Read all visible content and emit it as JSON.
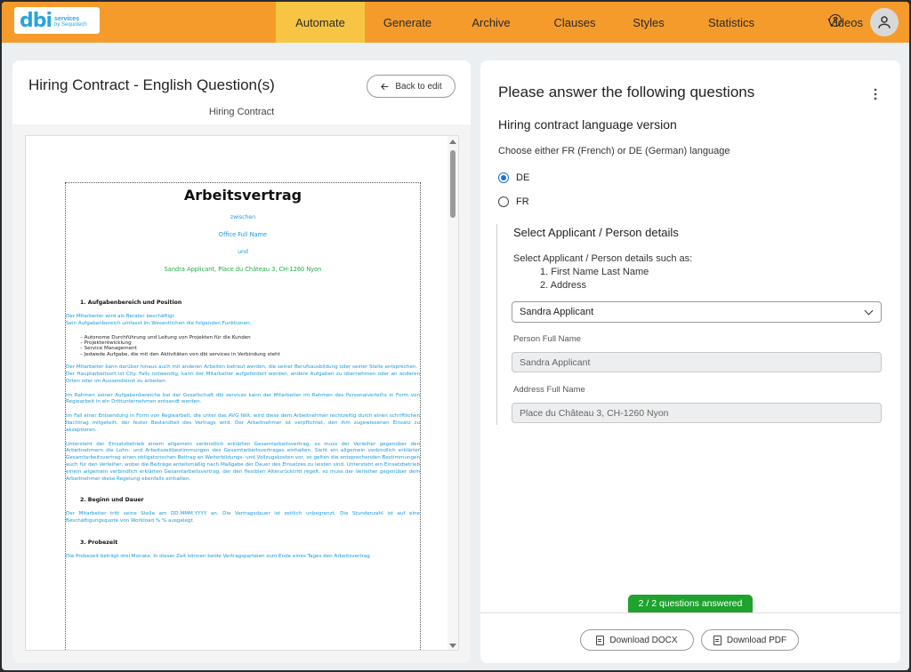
{
  "logo": {
    "brand": "dbi",
    "sub_top": "services",
    "sub_bottom": "by Sequotech"
  },
  "nav": {
    "items": [
      {
        "label": "Automate",
        "active": true
      },
      {
        "label": "Generate",
        "active": false
      },
      {
        "label": "Archive",
        "active": false
      },
      {
        "label": "Clauses",
        "active": false
      },
      {
        "label": "Styles",
        "active": false
      },
      {
        "label": "Statistics",
        "active": false
      },
      {
        "label": "Videos",
        "active": false
      }
    ],
    "help_icon": "?"
  },
  "left": {
    "title": "Hiring Contract - English Question(s)",
    "back_label": "Back to edit",
    "subtitle": "Hiring Contract",
    "document": {
      "heading": "Arbeitsvertrag",
      "between": "zwischen",
      "party1": "Office Full Name",
      "and": "und",
      "party2": "Sandra Applicant, Place du Château 3, CH-1260 Nyon",
      "sec1": "1.    Aufgabenbereich und Position",
      "p1": "Der Mitarbeiter wird als Berater beschäftigt.",
      "p1b": "Sein Aufgabenbereich umfasst im Wesentlichen die folgenden Funktionen:",
      "list": [
        "–   Autonome Durchführung und Leitung von Projekten für die Kunden",
        "–   Projektentwicklung",
        "–   Service Management",
        "–   Jedwede Aufgabe, die mit den Aktivitäten von dbi services in Verbindung steht"
      ],
      "p2": "Der Mitarbeiter kann darüber hinaus auch mit anderen Arbeiten betraut werden, die seiner Berufsausbildung oder seiner Stelle entsprechen.",
      "p3": "Der Hauptarbeitsort ist City. Falls notwendig, kann der Mitarbeiter aufgefordert werden, andere Aufgaben zu übernehmen oder an anderen Orten oder im Aussendienst zu arbeiten.",
      "p4": "Im Rahmen seiner Aufgabenbereiche bei der Gesellschaft dbi services kann der Mitarbeiter im Rahmen des Personalverleihs in Form von Regiearbeit in ein Drittunternehmen entsandt werden.",
      "p5": "Im Fall einer Entsendung in Form von Regiearbeit, die unter das AVG fällt, wird diese dem Arbeitnehmer rechtzeitig durch einen schriftlichen Nachtrag mitgeteilt, der fester Bestandteil des Vertrags wird. Der Arbeitnehmer ist verpflichtet, den ihm zugewiesenen Einsatz zu akzeptieren.",
      "p6": "Untersteht der Einsatzbetrieb einem allgemein verbindlich erklärten Gesamtarbeitsvertrag, so muss der Verleiher gegenüber den Arbeitnehmern die Lohn- und Arbeitszeitbestimmungen des Gesamtarbeitsvertrages einhalten. Sieht ein allgemein verbindlich erklärter Gesamtarbeitsvertrag einen obligatorischen Beitrag an Weiterbildungs- und Vollzugskosten vor, so gelten die entsprechenden Bestimmungen auch für den Verleiher, wobei die Beiträge anteilsmäßig nach Maßgabe der Dauer des Einsatzes zu leisten sind. Untersteht ein Einsatzbetrieb einem allgemein verbindlich erklärten Gesamtarbeitsvertrag, der den flexiblen Altersrücktritt regelt, so muss der Verleiher gegenüber dem Arbeitnehmer diese Regelung ebenfalls einhalten.",
      "sec2": "2.    Beginn und Dauer",
      "p7": "Der Mitarbeiter tritt seine Stelle am DD.MMM.YYYY an. Die Vertragsdauer ist zeitlich unbegrenzt. Die Stundenzahl ist auf eine Beschäftigungsquote von Workload % % ausgelegt.",
      "sec3": "3.    Probezeit",
      "p8": "Die Probezeit beträgt drei Monate. In dieser Zeit können beide Vertragsparteien zum Ende eines Tages den Arbeitsvertrag"
    }
  },
  "right": {
    "title": "Please answer the following questions",
    "q1": {
      "title": "Hiring contract language version",
      "hint": "Choose either FR (French) or DE (German) language",
      "options": [
        {
          "label": "DE",
          "selected": true
        },
        {
          "label": "FR",
          "selected": false
        }
      ]
    },
    "q2": {
      "title": "Select Applicant / Person details",
      "desc": "Select Applicant / Person details such as:",
      "items": [
        "1. First Name Last Name",
        "2. Address"
      ],
      "selected": "Sandra Applicant",
      "person_label": "Person Full Name",
      "person_value": "Sandra Applicant",
      "address_label": "Address Full Name",
      "address_value": "Place du Château 3, CH-1260 Nyon"
    },
    "progress": "2 / 2 questions answered",
    "download_docx": "Download DOCX",
    "download_pdf": "Download PDF"
  },
  "colors": {
    "topbar": "#f49b2c",
    "nav_active": "#f7c543",
    "accent_blue": "#1a9ad6",
    "success_green": "#1fa22e"
  }
}
